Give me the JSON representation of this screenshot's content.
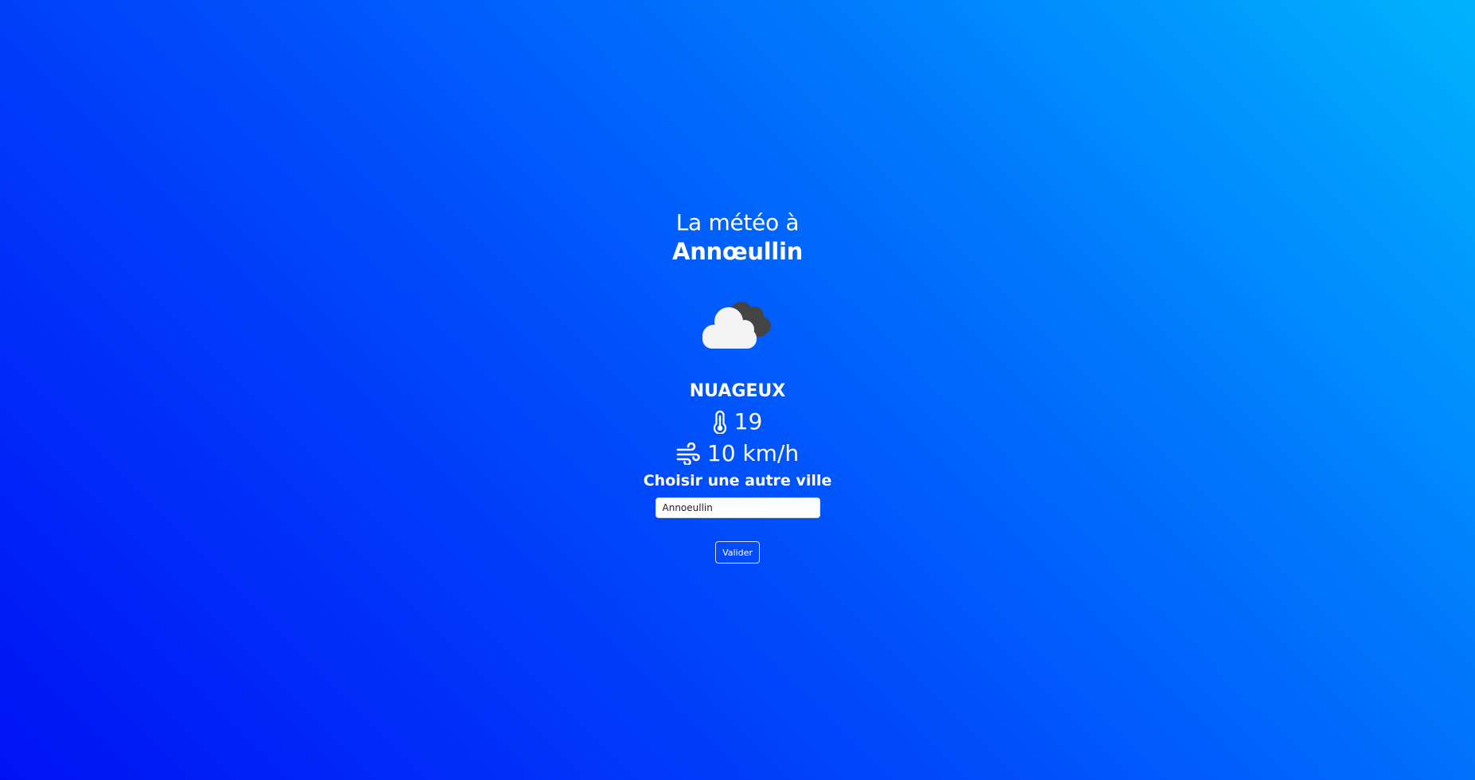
{
  "header": {
    "intro": "La météo à",
    "city": "Annœullin"
  },
  "weather": {
    "icon": "cloudy-icon",
    "condition": "NUAGEUX",
    "temperature_icon": "thermometer-icon",
    "temperature": "19",
    "wind_icon": "wind-icon",
    "wind": "10 km/h"
  },
  "form": {
    "title": "Choisir une autre ville",
    "city_value": "Annoeullin",
    "submit_label": "Valider"
  },
  "colors": {
    "background_start": "#0012f5",
    "background_end": "#00b3fd",
    "text": "#ffffff",
    "cloud_light": "#f2f2f2",
    "cloud_dark": "#444444"
  }
}
